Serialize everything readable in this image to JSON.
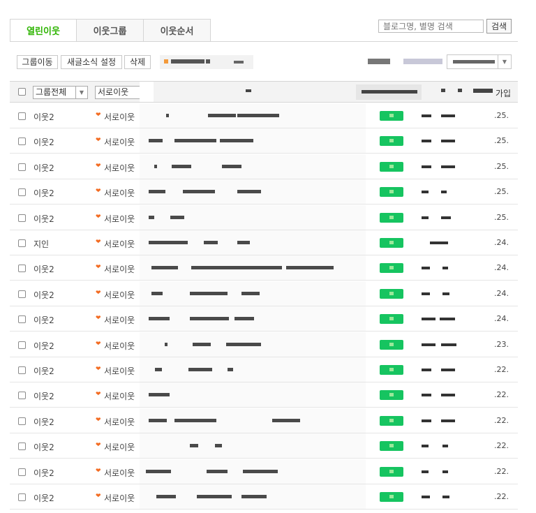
{
  "tabs": [
    "열린이웃",
    "이웃그룹",
    "이웃순서"
  ],
  "search": {
    "placeholder": "블로그명, 별명 검색",
    "button": "검색"
  },
  "toolbar": {
    "move_group": "그룹이동",
    "news_setting": "새글소식 설정",
    "delete": "삭제"
  },
  "header": {
    "group_filter": "그룹전체",
    "relation_filter": "서로이웃",
    "joined": "가입"
  },
  "colors": {
    "accent": "#2db400",
    "badge": "#16c460",
    "heart": "#f36b21"
  },
  "rows": [
    {
      "group": "이웃2",
      "relation": "서로이웃",
      "date": ".25."
    },
    {
      "group": "이웃2",
      "relation": "서로이웃",
      "date": ".25."
    },
    {
      "group": "이웃2",
      "relation": "서로이웃",
      "date": ".25."
    },
    {
      "group": "이웃2",
      "relation": "서로이웃",
      "date": ".25."
    },
    {
      "group": "이웃2",
      "relation": "서로이웃",
      "date": ".25."
    },
    {
      "group": "지인",
      "relation": "서로이웃",
      "date": ".24."
    },
    {
      "group": "이웃2",
      "relation": "서로이웃",
      "date": ".24."
    },
    {
      "group": "이웃2",
      "relation": "서로이웃",
      "date": ".24."
    },
    {
      "group": "이웃2",
      "relation": "서로이웃",
      "date": ".24."
    },
    {
      "group": "이웃2",
      "relation": "서로이웃",
      "date": ".23."
    },
    {
      "group": "이웃2",
      "relation": "서로이웃",
      "date": ".22."
    },
    {
      "group": "이웃2",
      "relation": "서로이웃",
      "date": ".22."
    },
    {
      "group": "이웃2",
      "relation": "서로이웃",
      "date": ".22."
    },
    {
      "group": "이웃2",
      "relation": "서로이웃",
      "date": ".22."
    },
    {
      "group": "이웃2",
      "relation": "서로이웃",
      "date": ".22."
    },
    {
      "group": "이웃2",
      "relation": "서로이웃",
      "date": ".22."
    }
  ]
}
